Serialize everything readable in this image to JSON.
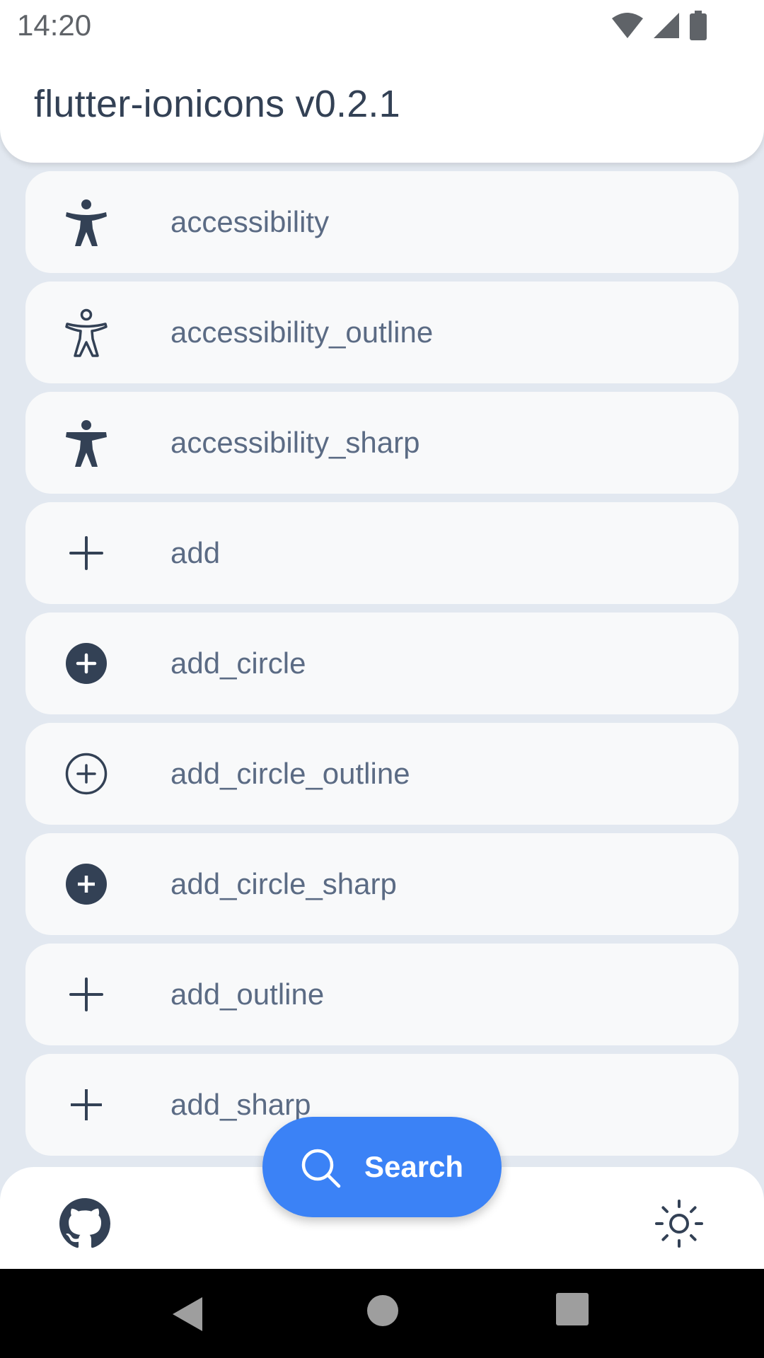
{
  "status_bar": {
    "time": "14:20",
    "icons": [
      "wifi-icon",
      "cellular-signal-icon",
      "battery-icon"
    ]
  },
  "app_bar": {
    "title": "flutter-ionicons v0.2.1"
  },
  "icon_list": {
    "items": [
      {
        "label": "accessibility",
        "icon": "accessibility-icon"
      },
      {
        "label": "accessibility_outline",
        "icon": "accessibility-outline-icon"
      },
      {
        "label": "accessibility_sharp",
        "icon": "accessibility-sharp-icon"
      },
      {
        "label": "add",
        "icon": "add-icon"
      },
      {
        "label": "add_circle",
        "icon": "add-circle-icon"
      },
      {
        "label": "add_circle_outline",
        "icon": "add-circle-outline-icon"
      },
      {
        "label": "add_circle_sharp",
        "icon": "add-circle-sharp-icon"
      },
      {
        "label": "add_outline",
        "icon": "add-outline-icon"
      },
      {
        "label": "add_sharp",
        "icon": "add-sharp-icon"
      }
    ]
  },
  "fab": {
    "label": "Search",
    "icon": "search-icon"
  },
  "bottom_bar": {
    "left_icon": "github-icon",
    "right_icon": "sun-icon"
  },
  "nav_bar": {
    "icons": [
      "back-icon",
      "home-icon",
      "recents-icon"
    ]
  },
  "colors": {
    "background": "#e2e8f0",
    "card": "#f8f9fa",
    "icon": "#334155",
    "label": "#5b6b84",
    "accent": "#3b82f6"
  }
}
